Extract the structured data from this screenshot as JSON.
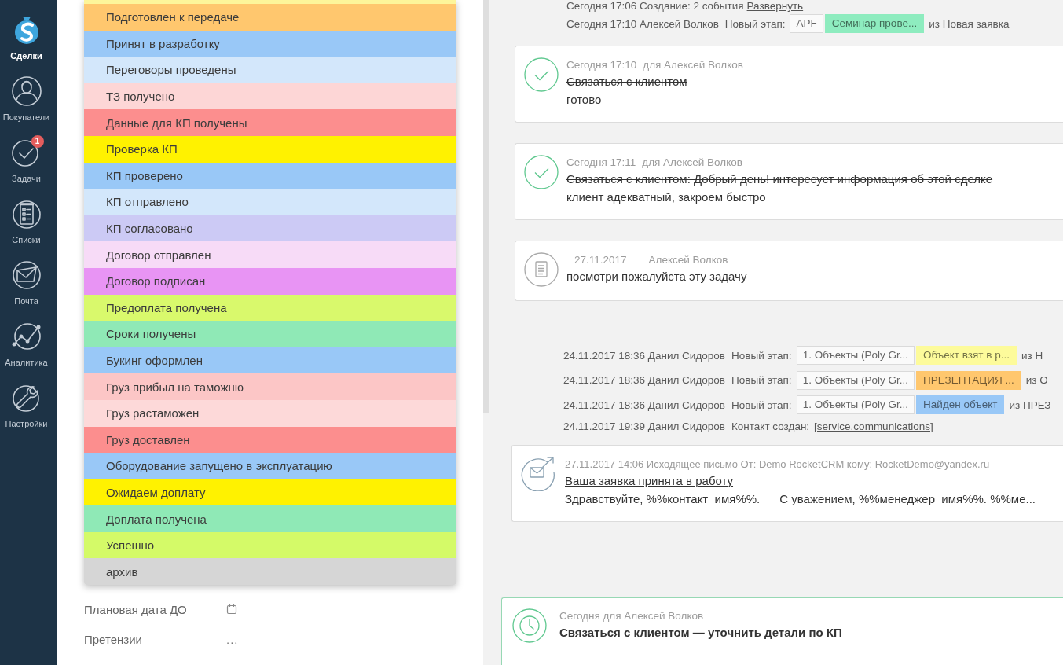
{
  "sidebar": {
    "items": [
      {
        "label": "Сделки",
        "kind": "logo",
        "selected": true
      },
      {
        "label": "Покупатели",
        "kind": "customers",
        "selected": false
      },
      {
        "label": "Задачи",
        "kind": "tasks",
        "selected": false,
        "badge": "1"
      },
      {
        "label": "Списки",
        "kind": "lists",
        "selected": false
      },
      {
        "label": "Почта",
        "kind": "mail",
        "selected": false
      },
      {
        "label": "Аналитика",
        "kind": "analytics",
        "selected": false
      },
      {
        "label": "Настройки",
        "kind": "settings",
        "selected": false
      }
    ]
  },
  "stage_dropdown": {
    "items": [
      {
        "label": "Подготовлен к передаче",
        "color": "#ffc76e"
      },
      {
        "label": "Принят в разработку",
        "color": "#99c8f7"
      },
      {
        "label": "Переговоры проведены",
        "color": "#d3e7fb"
      },
      {
        "label": "ТЗ получено",
        "color": "#fdd6d6"
      },
      {
        "label": "Данные для КП получены",
        "color": "#fc8e8e"
      },
      {
        "label": "Проверка КП",
        "color": "#fff200"
      },
      {
        "label": "КП проверено",
        "color": "#99c8f7"
      },
      {
        "label": "КП отправлено",
        "color": "#d3e7fb"
      },
      {
        "label": "КП согласовано",
        "color": "#cccaf5"
      },
      {
        "label": "Договор отправлен",
        "color": "#f7dbf7"
      },
      {
        "label": "Договор подписан",
        "color": "#e894f4"
      },
      {
        "label": "Предоплата получена",
        "color": "#d9f96c"
      },
      {
        "label": "Сроки получены",
        "color": "#8fe9b6"
      },
      {
        "label": "Букинг оформлен",
        "color": "#99c8f7"
      },
      {
        "label": "Груз прибыл на таможню",
        "color": "#fcc6c6"
      },
      {
        "label": "Груз растаможен",
        "color": "#fdd9d9"
      },
      {
        "label": "Груз доставлен",
        "color": "#fc8e8e"
      },
      {
        "label": "Оборудование запущено в эксплуатацию",
        "color": "#99c8f7"
      },
      {
        "label": "Ожидаем доплату",
        "color": "#fff200"
      },
      {
        "label": "Доплата получена",
        "color": "#8fe9b6"
      },
      {
        "label": "Успешно",
        "color": "#d4fa68"
      },
      {
        "label": "архив",
        "color": "#d6d6d6"
      }
    ]
  },
  "fields": [
    {
      "label": "Плановая дата ДО",
      "kind": "date"
    },
    {
      "label": "Претензии",
      "kind": "text",
      "value": "..."
    }
  ],
  "feed": [
    {
      "kind": "summary",
      "text": "Сегодня 17:06 Создание: 2 события",
      "link": "Развернуть"
    },
    {
      "kind": "stage",
      "who": "Сегодня 17:10 Алексей Волков",
      "action": "Новый этап:",
      "pipeline": "APF",
      "stage": "Семинар прове...",
      "color": "#8eecbf",
      "from": "из Новая заявка"
    },
    {
      "kind": "task",
      "done": true,
      "time": "Сегодня 17:10",
      "assignee": "для Алексей Волков",
      "title": "Связаться с клиентом",
      "result": "готово"
    },
    {
      "kind": "task",
      "done": true,
      "time": "Сегодня 17:11",
      "assignee": "для Алексей Волков",
      "title": "Связаться с клиентом: Добрый день! интересует информация об этой сделке",
      "result": "клиент адекватный, закроем быстро"
    },
    {
      "kind": "note",
      "date": "27.11.2017",
      "author": "Алексей Волков",
      "text": "посмотри пожалуйста эту задачу"
    },
    {
      "kind": "stage",
      "who": "24.11.2017 18:36 Данил Сидоров",
      "action": "Новый этап:",
      "pipeline": "1. Объекты (Poly Gr...",
      "stage": "Объект взят в р...",
      "color": "#fdfb9b",
      "from": "из Н"
    },
    {
      "kind": "stage",
      "who": "24.11.2017 18:36 Данил Сидоров",
      "action": "Новый этап:",
      "pipeline": "1. Объекты (Poly Gr...",
      "stage": "ПРЕЗЕНТАЦИЯ ...",
      "color": "#ffc76e",
      "from": "из О"
    },
    {
      "kind": "stage",
      "who": "24.11.2017 18:36 Данил Сидоров",
      "action": "Новый этап:",
      "pipeline": "1. Объекты (Poly Gr...",
      "stage": "Найден объект",
      "color": "#99c8f7",
      "from": "из ПРЕЗ"
    },
    {
      "kind": "contact",
      "who": "24.11.2017 19:39 Данил Сидоров",
      "action": "Контакт создан:",
      "link": "[service.communications]"
    },
    {
      "kind": "email",
      "meta": "27.11.2017 14:06 Исходящее письмо От: Demo RocketCRM кому: RocketDemo@yandex.ru",
      "subject": "Ваша заявка принята в работу",
      "preview": "Здравствуйте, %%контакт_имя%%. __ С уважением, %%менеджер_имя%%. %%ме..."
    }
  ],
  "upcoming_task": {
    "meta": "Сегодня для Алексей Волков",
    "title": "Связаться с клиентом — уточнить детали по КП"
  }
}
